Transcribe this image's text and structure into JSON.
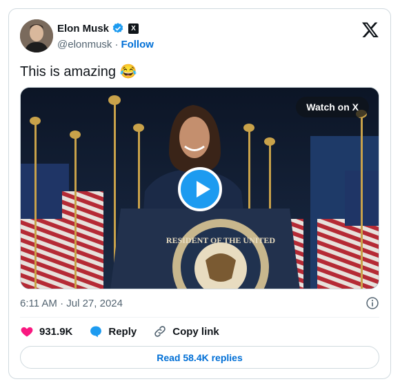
{
  "author": {
    "display_name": "Elon Musk",
    "handle": "@elonmusk",
    "separator": "·",
    "follow_label": "Follow"
  },
  "tweet": {
    "text": "This is amazing",
    "emoji": "😂",
    "timestamp": "6:11 AM · Jul 27, 2024"
  },
  "media": {
    "watch_label": "Watch on X",
    "seal_text": "RESIDENT OF THE UNITED"
  },
  "actions": {
    "likes": "931.9K",
    "reply_label": "Reply",
    "copy_link_label": "Copy link"
  },
  "read_replies_label": "Read 58.4K replies",
  "colors": {
    "link_blue": "#006fd6",
    "verified_blue": "#1d9bf0",
    "like_pink": "#f91880",
    "muted": "#536471"
  },
  "icons": [
    "verified-icon",
    "x-affiliate-badge-icon",
    "x-logo-icon",
    "play-icon",
    "info-icon",
    "heart-icon",
    "reply-icon",
    "link-icon"
  ]
}
